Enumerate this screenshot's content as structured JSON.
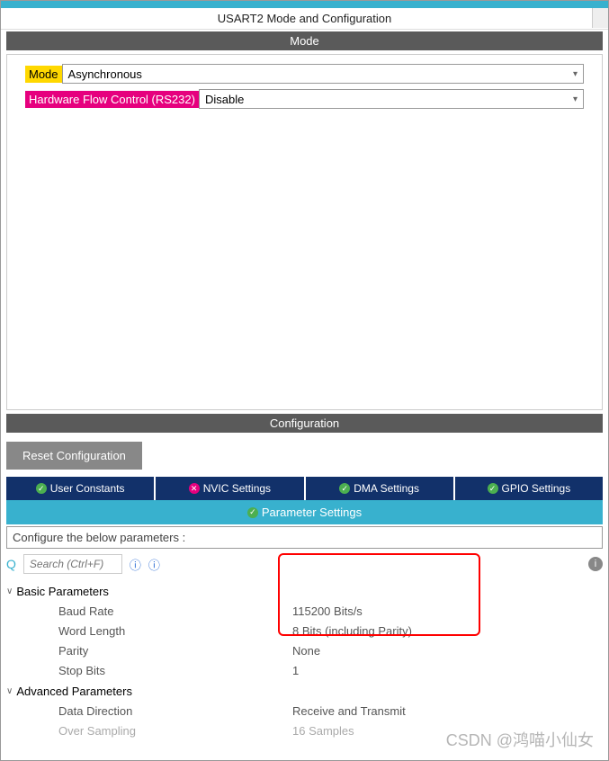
{
  "header": {
    "title": "USART2 Mode and Configuration"
  },
  "mode_section": {
    "header": "Mode",
    "mode_label": "Mode",
    "mode_value": "Asynchronous",
    "hw_label": "Hardware Flow Control (RS232)",
    "hw_value": "Disable"
  },
  "config_section": {
    "header": "Configuration",
    "reset_button": "Reset Configuration",
    "tabs": {
      "user_constants": "User Constants",
      "nvic": "NVIC Settings",
      "dma": "DMA Settings",
      "gpio": "GPIO Settings",
      "parameter": "Parameter Settings"
    },
    "configure_text": "Configure the below parameters :",
    "search_placeholder": "Search (Ctrl+F)"
  },
  "params": {
    "basic_header": "Basic Parameters",
    "advanced_header": "Advanced Parameters",
    "baud_rate_label": "Baud Rate",
    "baud_rate_value": "115200 Bits/s",
    "word_length_label": "Word Length",
    "word_length_value": "8 Bits (including Parity)",
    "parity_label": "Parity",
    "parity_value": "None",
    "stop_bits_label": "Stop Bits",
    "stop_bits_value": "1",
    "data_direction_label": "Data Direction",
    "data_direction_value": "Receive and Transmit",
    "over_sampling_label": "Over Sampling",
    "over_sampling_value": "16 Samples"
  },
  "watermark": "CSDN @鸿喵小仙女"
}
